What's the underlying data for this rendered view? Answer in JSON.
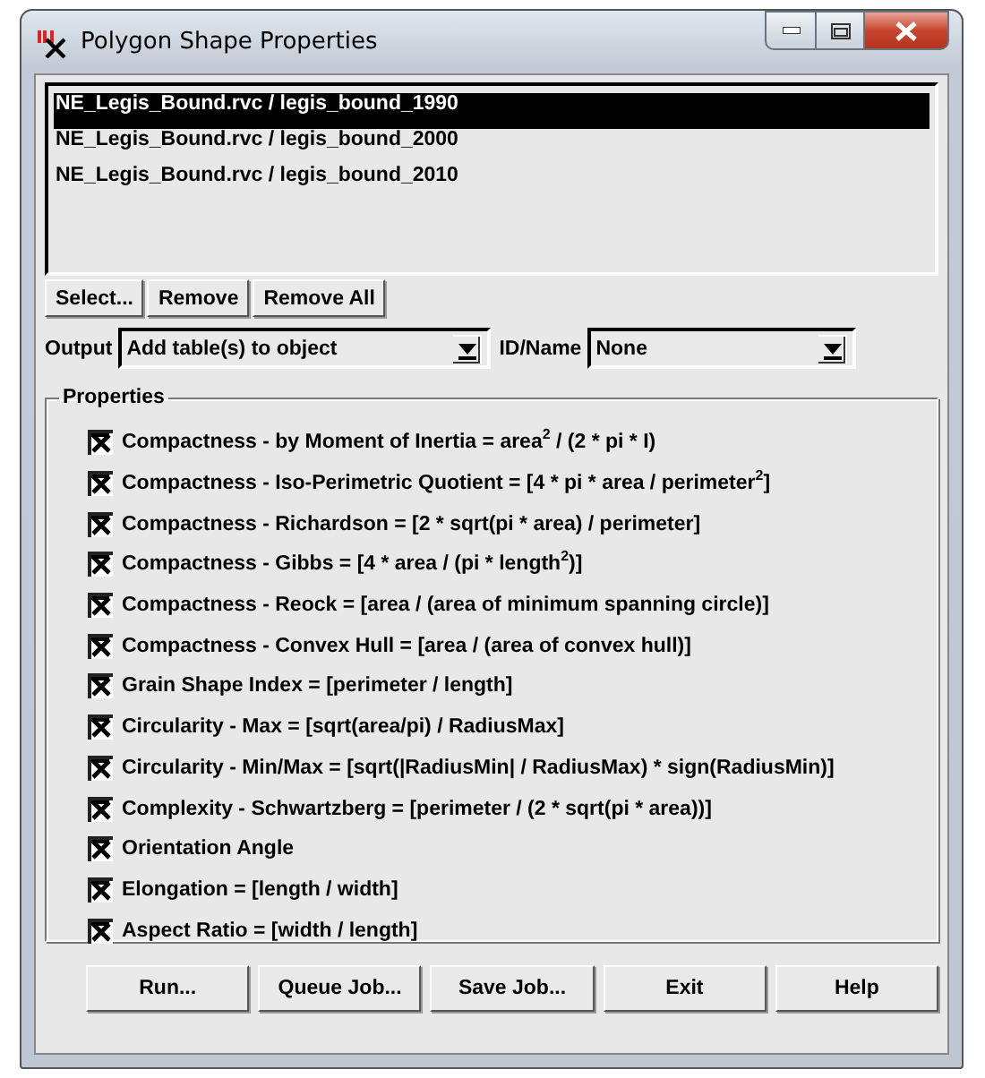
{
  "window": {
    "title": "Polygon Shape Properties"
  },
  "layers": [
    {
      "label": "NE_Legis_Bound.rvc / legis_bound_1990",
      "selected": true
    },
    {
      "label": "NE_Legis_Bound.rvc / legis_bound_2000",
      "selected": false
    },
    {
      "label": "NE_Legis_Bound.rvc / legis_bound_2010",
      "selected": false
    }
  ],
  "list_buttons": [
    "Select...",
    "Remove",
    "Remove All"
  ],
  "output": {
    "label": "Output",
    "value": "Add table(s) to object"
  },
  "id_name": {
    "label": "ID/Name",
    "value": "None"
  },
  "properties": {
    "title": "Properties",
    "items": [
      {
        "label": "Compactness - by Moment of Inertia = area$^{2}$ / (2 * pi * I)",
        "checked": true
      },
      {
        "label": "Compactness - Iso-Perimetric Quotient = [4 * pi * area / perimeter$^{2}$]",
        "checked": true
      },
      {
        "label": "Compactness - Richardson = [2 * sqrt(pi * area) / perimeter]",
        "checked": true
      },
      {
        "label": "Compactness - Gibbs = [4 * area / (pi * length$^{2}$)]",
        "checked": true
      },
      {
        "label": "Compactness - Reock = [area / (area of minimum spanning circle)]",
        "checked": true
      },
      {
        "label": "Compactness - Convex Hull = [area / (area of convex hull)]",
        "checked": true
      },
      {
        "label": "Grain Shape Index = [perimeter / length]",
        "checked": true
      },
      {
        "label": "Circularity - Max = [sqrt(area/pi) / RadiusMax]",
        "checked": true
      },
      {
        "label": "Circularity - Min/Max = [sqrt(|RadiusMin| / RadiusMax) * sign(RadiusMin)]",
        "checked": true
      },
      {
        "label": "Complexity - Schwartzberg = [perimeter / (2 * sqrt(pi * area))]",
        "checked": true
      },
      {
        "label": "Orientation Angle",
        "checked": true
      },
      {
        "label": "Elongation = [length / width]",
        "checked": true
      },
      {
        "label": "Aspect Ratio = [width / length]",
        "checked": true
      }
    ]
  },
  "buttons": [
    "Run...",
    "Queue Job...",
    "Save Job...",
    "Exit",
    "Help"
  ]
}
